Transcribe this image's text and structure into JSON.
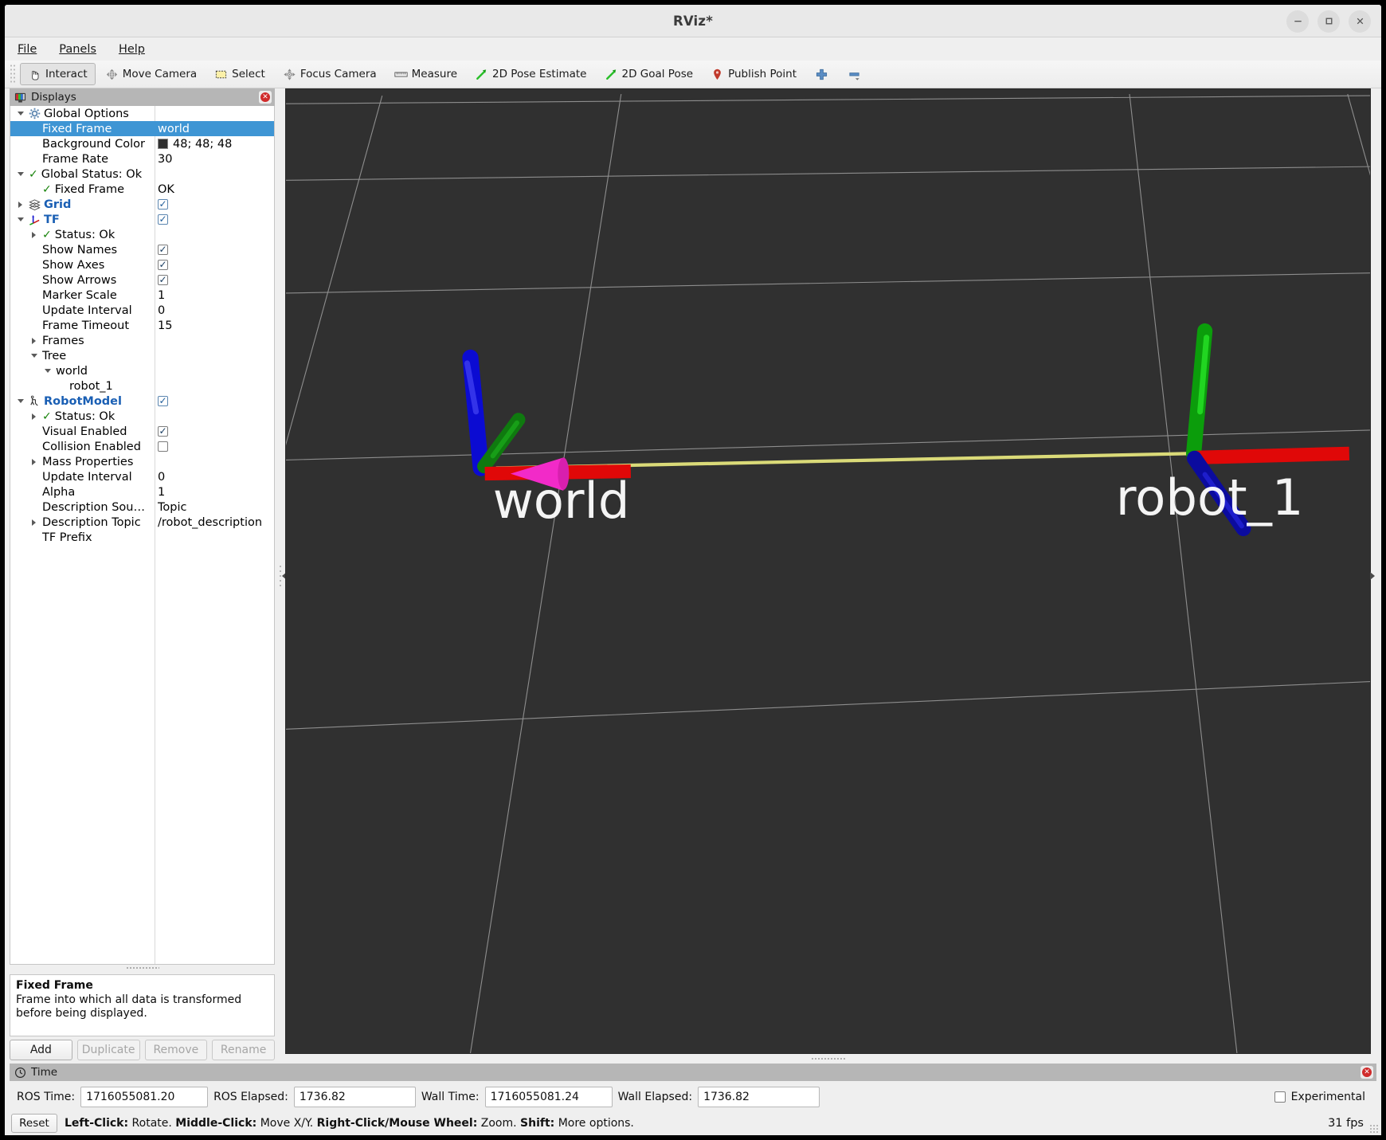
{
  "window": {
    "title": "RViz*",
    "controls": [
      {
        "name": "minimize-button",
        "glyph": "minimize-icon"
      },
      {
        "name": "maximize-button",
        "glyph": "maximize-icon"
      },
      {
        "name": "close-button",
        "glyph": "close-icon"
      }
    ]
  },
  "menubar": {
    "items": [
      {
        "label": "File",
        "mnemonic": "F"
      },
      {
        "label": "Panels",
        "mnemonic": "P"
      },
      {
        "label": "Help",
        "mnemonic": "H"
      }
    ]
  },
  "toolbar": {
    "buttons": [
      {
        "label": "Interact",
        "icon": "hand-cursor-icon",
        "active": true
      },
      {
        "label": "Move Camera",
        "icon": "move-camera-icon",
        "active": false
      },
      {
        "label": "Select",
        "icon": "select-rect-icon",
        "active": false
      },
      {
        "label": "Focus Camera",
        "icon": "focus-camera-icon",
        "active": false
      },
      {
        "label": "Measure",
        "icon": "ruler-icon",
        "active": false
      },
      {
        "label": "2D Pose Estimate",
        "icon": "green-arrow-icon",
        "active": false
      },
      {
        "label": "2D Goal Pose",
        "icon": "green-arrow-icon",
        "active": false
      },
      {
        "label": "Publish Point",
        "icon": "map-pin-icon",
        "active": false
      },
      {
        "label": "",
        "icon": "plus-icon",
        "active": false
      },
      {
        "label": "",
        "icon": "minus-dropdown-icon",
        "active": false
      }
    ]
  },
  "displays_panel": {
    "header_title": "Displays",
    "header_icon": "displays-monitor-icon",
    "close_icon": "close-dock-icon",
    "rows": [
      {
        "indent": 0,
        "arrow": "down",
        "icon": "gear-icon",
        "label": "Global Options",
        "value_type": "none",
        "value": "",
        "bold_blue": false,
        "selected": false
      },
      {
        "indent": 1,
        "arrow": "none",
        "icon": "none",
        "label": "Fixed Frame",
        "value_type": "text",
        "value": "world",
        "bold_blue": false,
        "selected": true
      },
      {
        "indent": 1,
        "arrow": "none",
        "icon": "none",
        "label": "Background Color",
        "value_type": "color",
        "value": "48; 48; 48",
        "bold_blue": false,
        "selected": false,
        "color_hex": "#303030"
      },
      {
        "indent": 1,
        "arrow": "none",
        "icon": "none",
        "label": "Frame Rate",
        "value_type": "text",
        "value": "30",
        "bold_blue": false,
        "selected": false
      },
      {
        "indent": 0,
        "arrow": "down",
        "icon": "check-icon",
        "label": "Global Status: Ok",
        "value_type": "none",
        "value": "",
        "bold_blue": false,
        "selected": false
      },
      {
        "indent": 1,
        "arrow": "none",
        "icon": "check-icon",
        "label": "Fixed Frame",
        "value_type": "text",
        "value": "OK",
        "bold_blue": false,
        "selected": false
      },
      {
        "indent": 0,
        "arrow": "right",
        "icon": "grid-icon",
        "label": "Grid",
        "value_type": "check",
        "value": "checked",
        "bold_blue": true,
        "selected": false
      },
      {
        "indent": 0,
        "arrow": "down",
        "icon": "tf-axes-icon",
        "label": "TF",
        "value_type": "check",
        "value": "checked",
        "bold_blue": true,
        "selected": false
      },
      {
        "indent": 1,
        "arrow": "right",
        "icon": "check-icon",
        "label": "Status: Ok",
        "value_type": "none",
        "value": "",
        "bold_blue": false,
        "selected": false
      },
      {
        "indent": 1,
        "arrow": "none",
        "icon": "none",
        "label": "Show Names",
        "value_type": "check",
        "value": "checked",
        "bold_blue": false,
        "selected": false
      },
      {
        "indent": 1,
        "arrow": "none",
        "icon": "none",
        "label": "Show Axes",
        "value_type": "check",
        "value": "checked",
        "bold_blue": false,
        "selected": false
      },
      {
        "indent": 1,
        "arrow": "none",
        "icon": "none",
        "label": "Show Arrows",
        "value_type": "check",
        "value": "checked",
        "bold_blue": false,
        "selected": false
      },
      {
        "indent": 1,
        "arrow": "none",
        "icon": "none",
        "label": "Marker Scale",
        "value_type": "text",
        "value": "1",
        "bold_blue": false,
        "selected": false
      },
      {
        "indent": 1,
        "arrow": "none",
        "icon": "none",
        "label": "Update Interval",
        "value_type": "text",
        "value": "0",
        "bold_blue": false,
        "selected": false
      },
      {
        "indent": 1,
        "arrow": "none",
        "icon": "none",
        "label": "Frame Timeout",
        "value_type": "text",
        "value": "15",
        "bold_blue": false,
        "selected": false
      },
      {
        "indent": 1,
        "arrow": "right",
        "icon": "none",
        "label": "Frames",
        "value_type": "none",
        "value": "",
        "bold_blue": false,
        "selected": false
      },
      {
        "indent": 1,
        "arrow": "down",
        "icon": "none",
        "label": "Tree",
        "value_type": "none",
        "value": "",
        "bold_blue": false,
        "selected": false
      },
      {
        "indent": 2,
        "arrow": "down",
        "icon": "none",
        "label": "world",
        "value_type": "none",
        "value": "",
        "bold_blue": false,
        "selected": false
      },
      {
        "indent": 3,
        "arrow": "none",
        "icon": "none",
        "label": "robot_1",
        "value_type": "none",
        "value": "",
        "bold_blue": false,
        "selected": false
      },
      {
        "indent": 0,
        "arrow": "down",
        "icon": "robot-icon",
        "label": "RobotModel",
        "value_type": "check",
        "value": "checked",
        "bold_blue": true,
        "selected": false
      },
      {
        "indent": 1,
        "arrow": "right",
        "icon": "check-icon",
        "label": "Status: Ok",
        "value_type": "none",
        "value": "",
        "bold_blue": false,
        "selected": false
      },
      {
        "indent": 1,
        "arrow": "none",
        "icon": "none",
        "label": "Visual Enabled",
        "value_type": "check",
        "value": "checked",
        "bold_blue": false,
        "selected": false
      },
      {
        "indent": 1,
        "arrow": "none",
        "icon": "none",
        "label": "Collision Enabled",
        "value_type": "check",
        "value": "unchecked",
        "bold_blue": false,
        "selected": false
      },
      {
        "indent": 1,
        "arrow": "right",
        "icon": "none",
        "label": "Mass Properties",
        "value_type": "none",
        "value": "",
        "bold_blue": false,
        "selected": false
      },
      {
        "indent": 1,
        "arrow": "none",
        "icon": "none",
        "label": "Update Interval",
        "value_type": "text",
        "value": "0",
        "bold_blue": false,
        "selected": false
      },
      {
        "indent": 1,
        "arrow": "none",
        "icon": "none",
        "label": "Alpha",
        "value_type": "text",
        "value": "1",
        "bold_blue": false,
        "selected": false
      },
      {
        "indent": 1,
        "arrow": "none",
        "icon": "none",
        "label": "Description Sou…",
        "value_type": "text",
        "value": "Topic",
        "bold_blue": false,
        "selected": false
      },
      {
        "indent": 1,
        "arrow": "right",
        "icon": "none",
        "label": "Description Topic",
        "value_type": "text",
        "value": "/robot_description",
        "bold_blue": false,
        "selected": false
      },
      {
        "indent": 1,
        "arrow": "none",
        "icon": "none",
        "label": "TF Prefix",
        "value_type": "none",
        "value": "",
        "bold_blue": false,
        "selected": false
      }
    ],
    "description": {
      "title": "Fixed Frame",
      "text": "Frame into which all data is transformed before being displayed."
    },
    "buttons": [
      {
        "label": "Add",
        "enabled": true
      },
      {
        "label": "Duplicate",
        "enabled": false
      },
      {
        "label": "Remove",
        "enabled": false
      },
      {
        "label": "Rename",
        "enabled": false
      }
    ]
  },
  "viewport": {
    "background_color": "#303030",
    "grid_color": "#b4b4b4",
    "frames": [
      {
        "name": "world",
        "label": "world",
        "label_color": "#ffffff"
      },
      {
        "name": "robot_1",
        "label": "robot_1",
        "label_color": "#ffffff"
      }
    ],
    "axis_colors": {
      "x": "#e00000",
      "y": "#00b300",
      "z": "#0000d8"
    },
    "arrow_color": "#ff30c0",
    "connector_color": "#d8d878"
  },
  "time_panel": {
    "header_title": "Time",
    "header_icon": "clock-icon",
    "close_icon": "close-dock-icon",
    "fields": [
      {
        "label": "ROS Time:",
        "value": "1716055081.20"
      },
      {
        "label": "ROS Elapsed:",
        "value": "1736.82"
      },
      {
        "label": "Wall Time:",
        "value": "1716055081.24"
      },
      {
        "label": "Wall Elapsed:",
        "value": "1736.82"
      }
    ],
    "experimental": {
      "label": "Experimental",
      "checked": false
    },
    "reset_label": "Reset",
    "hint_segments": [
      {
        "text": "Left-Click:",
        "bold": true
      },
      {
        "text": " Rotate. ",
        "bold": false
      },
      {
        "text": "Middle-Click:",
        "bold": true
      },
      {
        "text": " Move X/Y. ",
        "bold": false
      },
      {
        "text": "Right-Click/Mouse Wheel:",
        "bold": true
      },
      {
        "text": " Zoom. ",
        "bold": false
      },
      {
        "text": "Shift:",
        "bold": true
      },
      {
        "text": " More options.",
        "bold": false
      }
    ],
    "fps": "31 fps"
  }
}
